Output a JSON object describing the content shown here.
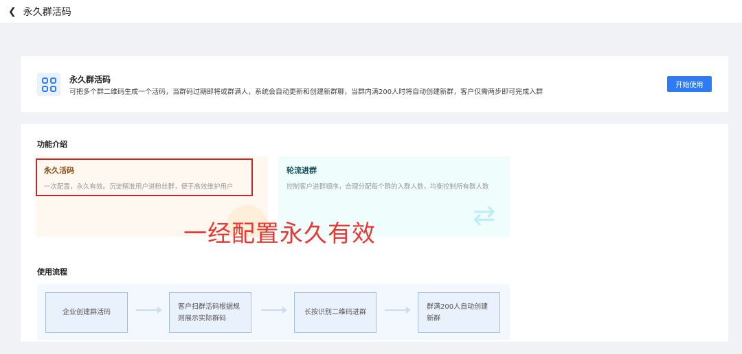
{
  "header": {
    "back_icon": "chevron-left-icon",
    "title": "永久群活码"
  },
  "intro": {
    "icon": "qr-code-icon",
    "title": "永久群活码",
    "description": "可把多个群二维码生成一个活码，当群码过期即将或群满人，系统会自动更新和创建新群聊，当群内满200人时将自动创建新群，客户仅需两步即可完成入群",
    "start_button": "开始使用"
  },
  "features": {
    "heading": "功能介绍",
    "items": [
      {
        "title": "永久活码",
        "description": "一次配置，永久有效。沉淀精准用户进粉丝群，便于高效维护用户",
        "color": "#8a4b0f"
      },
      {
        "title": "轮流进群",
        "description": "控制客户进群顺序，合理分配每个群的入群人数，均衡控制所有群人数",
        "color": "#0f4c57"
      }
    ]
  },
  "annotation": "一经配置永久有效",
  "flow": {
    "heading": "使用流程",
    "steps": [
      "企业创建群活码",
      "客户扫群活码根据规则展示实际群码",
      "长按识别二维码进群",
      "群满200人自动创建新群"
    ]
  }
}
